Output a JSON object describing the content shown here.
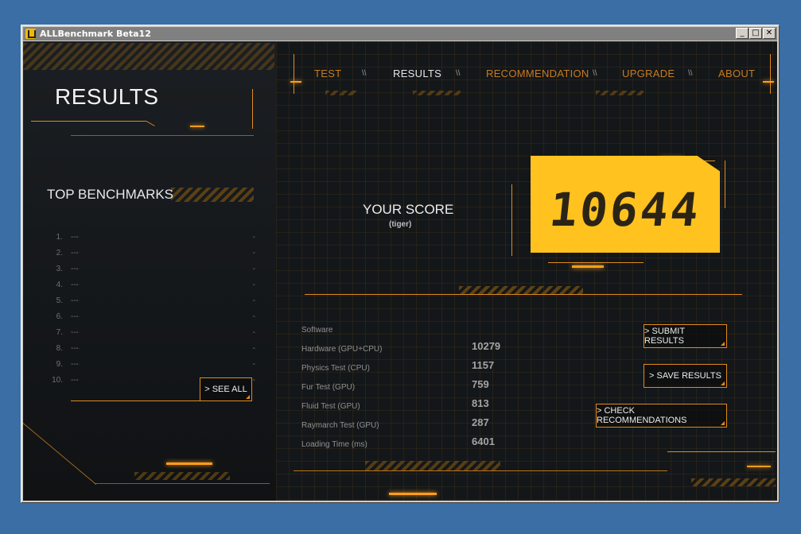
{
  "window": {
    "title": "ALLBenchmark Beta12",
    "minimize": "_",
    "maximize": "□",
    "close": "✕"
  },
  "nav": {
    "items": [
      {
        "label": "TEST",
        "active": false
      },
      {
        "label": "RESULTS",
        "active": true
      },
      {
        "label": "RECOMMENDATION",
        "active": false
      },
      {
        "label": "UPGRADE",
        "active": false
      },
      {
        "label": "ABOUT",
        "active": false
      }
    ],
    "separator": "\\\\"
  },
  "page": {
    "title": "RESULTS"
  },
  "top_benchmarks": {
    "title": "TOP BENCHMARKS",
    "rows": [
      {
        "num": "1.",
        "name": "---",
        "score": "-"
      },
      {
        "num": "2.",
        "name": "---",
        "score": "-"
      },
      {
        "num": "3.",
        "name": "---",
        "score": "-"
      },
      {
        "num": "4.",
        "name": "---",
        "score": "-"
      },
      {
        "num": "5.",
        "name": "---",
        "score": "-"
      },
      {
        "num": "6.",
        "name": "---",
        "score": "-"
      },
      {
        "num": "7.",
        "name": "---",
        "score": "-"
      },
      {
        "num": "8.",
        "name": "---",
        "score": "-"
      },
      {
        "num": "9.",
        "name": "---",
        "score": "-"
      },
      {
        "num": "10.",
        "name": "---",
        "score": "-"
      }
    ],
    "see_all": "> SEE ALL"
  },
  "score": {
    "label": "YOUR SCORE",
    "user": "(tiger)",
    "value": "10644"
  },
  "results": [
    {
      "label": "Software",
      "value": ""
    },
    {
      "label": "Hardware (GPU+CPU)",
      "value": "10279"
    },
    {
      "label": "Physics Test (CPU)",
      "value": "1157"
    },
    {
      "label": "Fur Test (GPU)",
      "value": "759"
    },
    {
      "label": "Fluid Test (GPU)",
      "value": "813"
    },
    {
      "label": "Raymarch Test (GPU)",
      "value": "287"
    },
    {
      "label": "Loading Time (ms)",
      "value": "6401"
    }
  ],
  "actions": {
    "submit": "> SUBMIT RESULTS",
    "save": "> SAVE RESULTS",
    "check": "> CHECK RECOMMENDATIONS"
  },
  "colors": {
    "accent": "#e08a1e",
    "score_bg": "#ffc21f",
    "background": "#15181b",
    "desktop": "#3a6ea5"
  }
}
